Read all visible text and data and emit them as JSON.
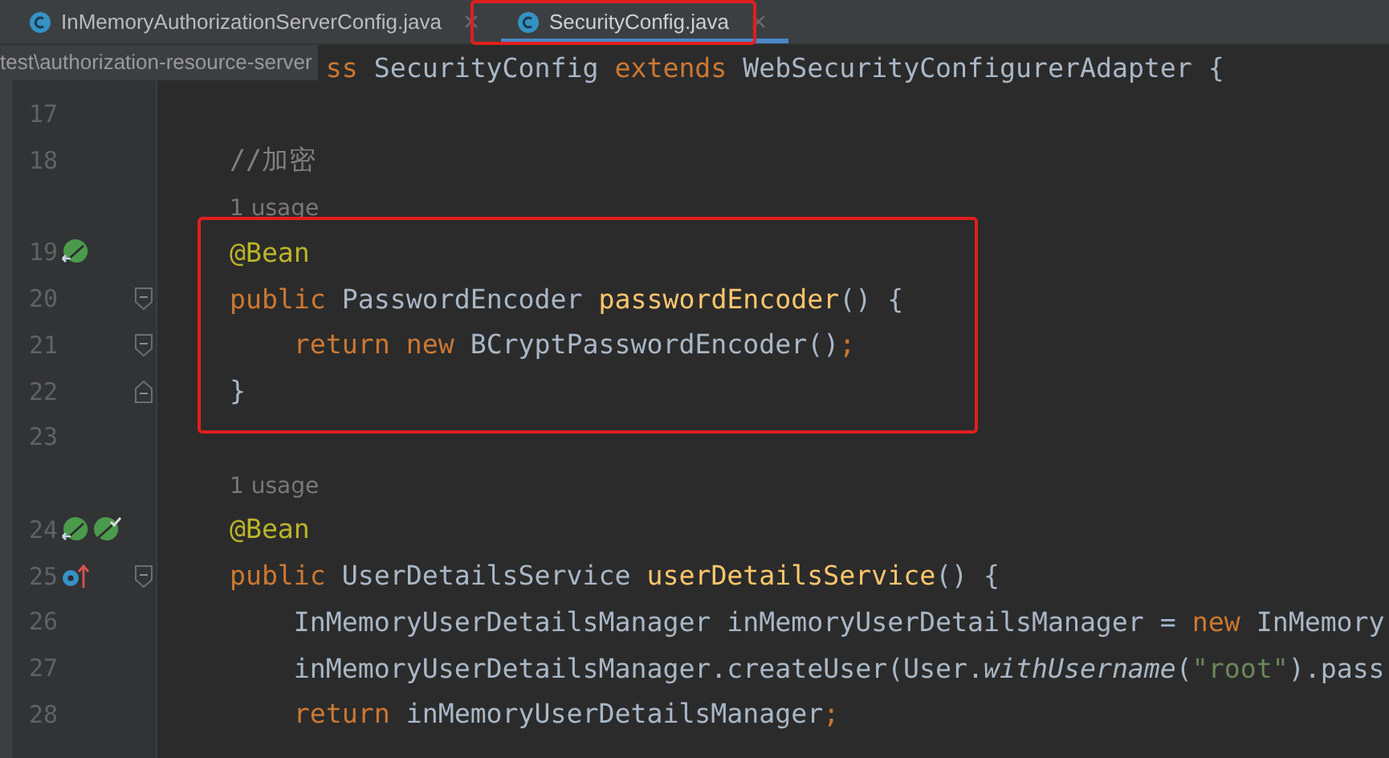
{
  "tabs": [
    {
      "label": "InMemoryAuthorizationServerConfig.java",
      "selected": false
    },
    {
      "label": "SecurityConfig.java",
      "selected": true
    }
  ],
  "lines": [
    {
      "kind": "code",
      "tooltip": "test\\authorization-resource-server",
      "tokens": [
        {
          "t": "ss ",
          "kind": "keyword"
        },
        {
          "t": "SecurityConfig ",
          "kind": "plain"
        },
        {
          "t": "extends ",
          "kind": "keyword"
        },
        {
          "t": "WebSecurityConfigurerAdapter {",
          "kind": "plain"
        }
      ]
    },
    {
      "kind": "code",
      "number": "17"
    },
    {
      "kind": "code",
      "number": "18",
      "tokens": [
        {
          "t": "    //加密",
          "kind": "comment"
        }
      ]
    },
    {
      "kind": "hint",
      "text": "1 usage"
    },
    {
      "kind": "code",
      "number": "19",
      "markers": [
        {
          "kind": "bean"
        }
      ],
      "tokens": [
        {
          "t": "    @Bean",
          "kind": "annotation"
        }
      ]
    },
    {
      "kind": "code",
      "number": "20",
      "fold": {
        "kind": "start"
      },
      "tokens": [
        {
          "t": "    public ",
          "kind": "keyword"
        },
        {
          "t": "PasswordEncoder ",
          "kind": "plain"
        },
        {
          "t": "passwordEncoder",
          "kind": "method"
        },
        {
          "t": "() {",
          "kind": "plain"
        }
      ]
    },
    {
      "kind": "code",
      "number": "21",
      "fold": {
        "kind": "start"
      },
      "tokens": [
        {
          "t": "        return new ",
          "kind": "keyword"
        },
        {
          "t": "BCryptPasswordEncoder()",
          "kind": "plain"
        },
        {
          "t": ";",
          "kind": "keyword"
        }
      ]
    },
    {
      "kind": "code",
      "number": "22",
      "fold": {
        "kind": "end"
      },
      "tokens": [
        {
          "t": "    }",
          "kind": "plain"
        }
      ]
    },
    {
      "kind": "code",
      "number": "23"
    },
    {
      "kind": "hint",
      "text": "1 usage"
    },
    {
      "kind": "code",
      "number": "24",
      "markers": [
        {
          "kind": "bean"
        },
        {
          "kind": "bean-check"
        }
      ],
      "tokens": [
        {
          "t": "    @Bean",
          "kind": "annotation"
        }
      ]
    },
    {
      "kind": "code",
      "number": "25",
      "markers": [
        {
          "kind": "override"
        }
      ],
      "fold": {
        "kind": "start"
      },
      "tokens": [
        {
          "t": "    public ",
          "kind": "keyword"
        },
        {
          "t": "UserDetailsService ",
          "kind": "plain"
        },
        {
          "t": "userDetailsService",
          "kind": "method"
        },
        {
          "t": "() {",
          "kind": "plain"
        }
      ]
    },
    {
      "kind": "code",
      "number": "26",
      "tokens": [
        {
          "t": "        InMemoryUserDetailsManager inMemoryUserDetailsManager = ",
          "kind": "plain"
        },
        {
          "t": "new ",
          "kind": "keyword"
        },
        {
          "t": "InMemory",
          "kind": "plain"
        }
      ]
    },
    {
      "kind": "code",
      "number": "27",
      "tokens": [
        {
          "t": "        inMemoryUserDetailsManager.createUser(User.",
          "kind": "plain"
        },
        {
          "t": "withUsername",
          "kind": "static"
        },
        {
          "t": "(",
          "kind": "plain"
        },
        {
          "t": "\"root\"",
          "kind": "string"
        },
        {
          "t": ").pass",
          "kind": "plain"
        }
      ]
    },
    {
      "kind": "code",
      "number": "28",
      "tokens": [
        {
          "t": "        return ",
          "kind": "keyword"
        },
        {
          "t": "inMemoryUserDetailsManager",
          "kind": "plain"
        },
        {
          "t": ";",
          "kind": "keyword"
        }
      ]
    }
  ],
  "highlights": [
    {
      "kind": "tab"
    },
    {
      "kind": "code"
    }
  ]
}
